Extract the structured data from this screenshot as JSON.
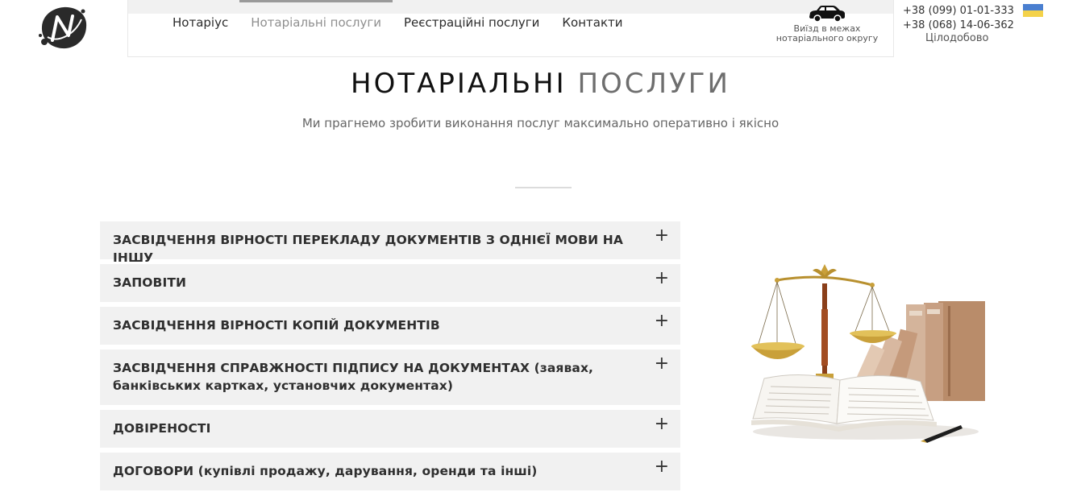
{
  "header": {
    "nav": [
      {
        "label": "Нотаріус",
        "active": false
      },
      {
        "label": "Нотаріальні послуги",
        "active": true
      },
      {
        "label": "Реєстраційні послуги",
        "active": false
      },
      {
        "label": "Контакти",
        "active": false
      }
    ],
    "travel": {
      "line1": "Виїзд в межах",
      "line2": "нотаріального округу"
    },
    "phones": [
      "+38 (099) 01-01-333",
      "+38 (068) 14-06-362"
    ],
    "hours": "Цілодобово",
    "language_flag": "ukraine-flag-icon"
  },
  "page": {
    "title_part1": "НОТАРІАЛЬНІ",
    "title_part2": "ПОСЛУГИ",
    "subtitle": "Ми прагнемо зробити виконання послуг максимально оперативно і якісно"
  },
  "services": [
    {
      "label": "ЗАСВІДЧЕННЯ ВІРНОСТІ ПЕРЕКЛАДУ ДОКУМЕНТІВ З ОДНІЄЇ МОВИ НА ІНШУ",
      "toggle": "+"
    },
    {
      "label": "ЗАПОВІТИ",
      "toggle": "+"
    },
    {
      "label": "ЗАСВІДЧЕННЯ ВІРНОСТІ КОПІЙ ДОКУМЕНТІВ",
      "toggle": "+"
    },
    {
      "label": "ЗАСВІДЧЕННЯ СПРАВЖНОСТІ ПІДПИСУ НА ДОКУМЕНТАХ (заявах, банківських картках, установчих документах)",
      "toggle": "+"
    },
    {
      "label": "ДОВІРЕНОСТІ",
      "toggle": "+"
    },
    {
      "label": "ДОГОВОРИ (купівлі продажу, дарування, оренди та інші)",
      "toggle": "+"
    }
  ],
  "colors": {
    "accordion_bg": "#f1f1f1",
    "flag_blue": "#4a7fd0",
    "flag_yellow": "#f4d24a",
    "active_nav": "#8f8f8f"
  }
}
